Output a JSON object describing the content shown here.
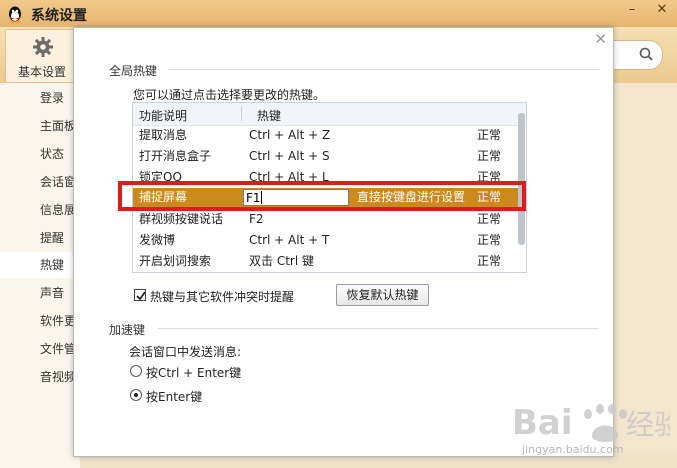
{
  "app": {
    "title": "系统设置",
    "toolbar_basic": "基本设置"
  },
  "sidebar": {
    "items": [
      {
        "label": "登录"
      },
      {
        "label": "主面板"
      },
      {
        "label": "状态"
      },
      {
        "label": "会话窗口"
      },
      {
        "label": "信息展示"
      },
      {
        "label": "提醒"
      },
      {
        "label": "热键"
      },
      {
        "label": "声音"
      },
      {
        "label": "软件更新"
      },
      {
        "label": "文件管理"
      },
      {
        "label": "音视频"
      }
    ],
    "active_index": 6
  },
  "dialog": {
    "section_global": "全局热键",
    "hint": "您可以通过点击选择要更改的热键。",
    "table": {
      "headers": {
        "func": "功能说明",
        "key": "热键"
      },
      "rows": [
        {
          "func": "提取消息",
          "key": "Ctrl + Alt + Z",
          "status": "正常"
        },
        {
          "func": "打开消息盒子",
          "key": "Ctrl + Alt + S",
          "status": "正常"
        },
        {
          "func": "锁定QQ",
          "key": "Ctrl + Alt + L",
          "status": "正常"
        },
        {
          "func": "捕捉屏幕",
          "key": "F1",
          "status": "正常",
          "hint": "直接按键盘进行设置"
        },
        {
          "func": "群视频按键说话",
          "key": "F2",
          "status": "正常"
        },
        {
          "func": "发微博",
          "key": "Ctrl + Alt + T",
          "status": "正常"
        },
        {
          "func": "开启划词搜索",
          "key": "双击 Ctrl 键",
          "status": "正常"
        }
      ]
    },
    "conflict_checkbox": {
      "label": "热键与其它软件冲突时提醒",
      "checked": true
    },
    "restore_button": "恢复默认热键",
    "section_accel": "加速键",
    "send_label": "会话窗口中发送消息:",
    "radio_ctrl_enter": {
      "label": "按Ctrl + Enter键",
      "selected": false
    },
    "radio_enter": {
      "label": "按Enter键",
      "selected": true
    }
  },
  "watermark": {
    "text": "jingyan.baidu.com"
  },
  "colors": {
    "selected_row": "#cc8a1e",
    "highlight_box": "#e01b1b",
    "title_bar": "#ecc07f"
  }
}
